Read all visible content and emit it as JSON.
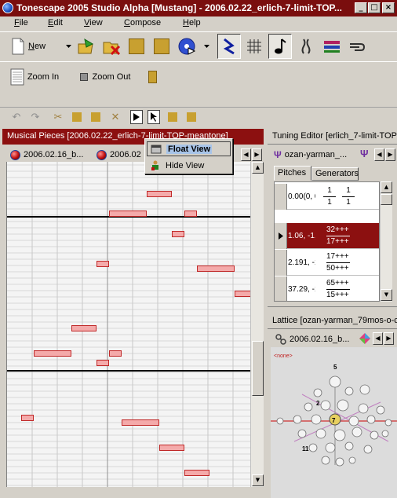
{
  "window": {
    "title": "Tonescape 2005 Studio Alpha [Mustang]  -  2006.02.22_erlich-7-limit-TOP...",
    "minimize": "_",
    "maximize": "□",
    "close": "×"
  },
  "menu": [
    "File",
    "Edit",
    "View",
    "Compose",
    "Help"
  ],
  "menu_underline": [
    "F",
    "E",
    "V",
    "C",
    "H"
  ],
  "menu_rest": [
    "ile",
    "dit",
    "iew",
    "ompose",
    "elp"
  ],
  "toolbar": {
    "new_label": "New",
    "new_underline": "N",
    "new_rest": "ew"
  },
  "zoom": {
    "zoom_in": "Zoom In",
    "zoom_out": "Zoom Out"
  },
  "musical_pieces": {
    "header": "Musical Pieces   [2006.02.22_erlich-7-limit-TOP-meantone]",
    "tabs": [
      "2006.02.16_b...",
      "2006.02"
    ]
  },
  "popup_menu": {
    "float_view": "Float View",
    "hide_view": "Hide View"
  },
  "tuning_editor": {
    "header": "Tuning Editor   [erlich_7-limit-TOP",
    "tab": "ozan-yarman_...",
    "subtabs": [
      "Pitches",
      "Generators"
    ],
    "rows": [
      {
        "value": "0.00(0, 0,",
        "num": "1",
        "den": "1"
      },
      {
        "value": "1.06, -1,",
        "num": "32+++",
        "den": "17+++"
      },
      {
        "value": "2.191, -1",
        "num": "17+++",
        "den": "50+++"
      },
      {
        "value": "37.29, -1",
        "num": "65+++",
        "den": "15+++"
      }
    ],
    "row_fracs": [
      [
        "1",
        "1"
      ],
      [
        "32",
        "+++"
      ],
      [
        "17",
        "+++"
      ],
      [
        "65",
        "+++"
      ]
    ]
  },
  "lattice": {
    "header": "Lattice   [ozan-yarman_79mos-o-c",
    "tab": "2006.02.16_b...",
    "none_label": "<none>",
    "node_labels": [
      "2",
      "7",
      "11",
      "5"
    ]
  },
  "colors": {
    "title_bar": "#7a0e0e",
    "panel_header": "#8c1010",
    "note_fill": "#f4aaaa",
    "note_border": "#c02828"
  }
}
